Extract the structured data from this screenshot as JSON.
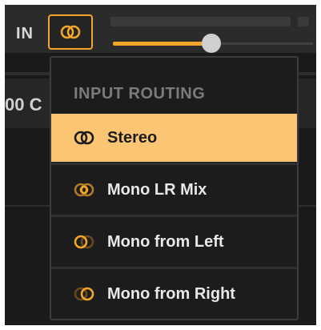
{
  "input": {
    "label": "IN",
    "output_gain_fraction": 0.49
  },
  "background": {
    "partial_text": "00 C"
  },
  "menu": {
    "header": "INPUT ROUTING",
    "items": [
      {
        "label": "Stereo",
        "icon": "stereo-icon",
        "selected": true
      },
      {
        "label": "Mono LR Mix",
        "icon": "mono-lr-mix-icon",
        "selected": false
      },
      {
        "label": "Mono from Left",
        "icon": "mono-left-icon",
        "selected": false
      },
      {
        "label": "Mono from Right",
        "icon": "mono-right-icon",
        "selected": false
      }
    ]
  },
  "colors": {
    "accent": "#f2a62a",
    "selected_bg": "#fcc574",
    "panel_bg": "#1c1c1c"
  }
}
